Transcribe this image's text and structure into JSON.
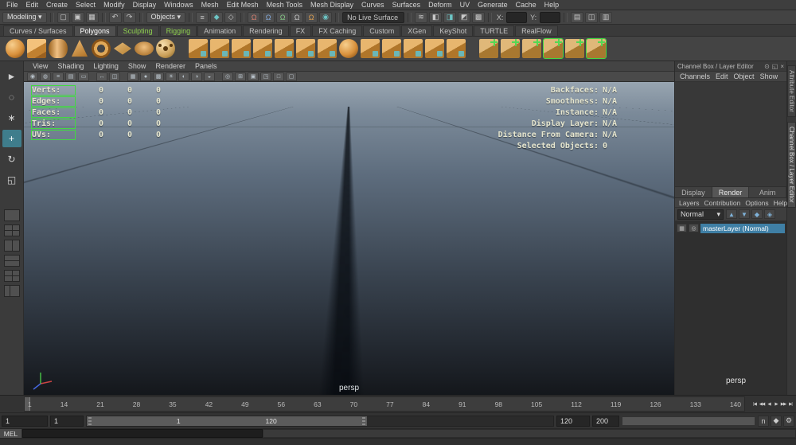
{
  "menu_bar": {
    "items": [
      "File",
      "Edit",
      "Create",
      "Select",
      "Modify",
      "Display",
      "Windows",
      "Mesh",
      "Edit Mesh",
      "Mesh Tools",
      "Mesh Display",
      "Curves",
      "Surfaces",
      "Deform",
      "UV",
      "Generate",
      "Cache",
      "Help"
    ]
  },
  "status_line": {
    "items": [
      {
        "name": "menu-set-dropdown",
        "glyph": "Modeling ▾",
        "cls": "dd"
      },
      {
        "cls": "sep"
      },
      {
        "name": "new-scene-icon",
        "glyph": "▢",
        "cls": "btn"
      },
      {
        "name": "open-scene-icon",
        "glyph": "▣",
        "cls": "btn"
      },
      {
        "name": "save-scene-icon",
        "glyph": "▦",
        "cls": "btn"
      },
      {
        "cls": "sep"
      },
      {
        "name": "undo-icon",
        "glyph": "↶",
        "cls": "btn"
      },
      {
        "name": "redo-icon",
        "glyph": "↷",
        "cls": "btn"
      },
      {
        "cls": "sep"
      },
      {
        "name": "selection-mask-dropdown",
        "glyph": "Objects ▾",
        "cls": "dd"
      },
      {
        "cls": "sep"
      },
      {
        "name": "select-by-hierarchy-icon",
        "glyph": "≡",
        "cls": "btn"
      },
      {
        "name": "select-by-object-icon",
        "glyph": "◆",
        "cls": "btn t-teal"
      },
      {
        "name": "select-by-component-icon",
        "glyph": "◇",
        "cls": "btn"
      },
      {
        "cls": "sep"
      },
      {
        "name": "snap-to-grid-icon",
        "glyph": "Ω",
        "cls": "btn t-red"
      },
      {
        "name": "snap-to-curve-icon",
        "glyph": "Ω",
        "cls": "btn t-blue"
      },
      {
        "name": "snap-to-point-icon",
        "glyph": "Ω",
        "cls": "btn t-green"
      },
      {
        "name": "snap-to-projected-center-icon",
        "glyph": "Ω",
        "cls": "btn"
      },
      {
        "name": "snap-to-view-plane-icon",
        "glyph": "Ω",
        "cls": "btn t-orange"
      },
      {
        "name": "make-live-icon",
        "glyph": "◉",
        "cls": "btn t-teal"
      },
      {
        "cls": "sep"
      },
      {
        "name": "live-surface-field",
        "glyph": "No Live Surface",
        "cls": "field"
      },
      {
        "cls": "sep"
      },
      {
        "name": "construction-history-icon",
        "glyph": "≋",
        "cls": "btn"
      },
      {
        "name": "open-render-view-icon",
        "glyph": "◧",
        "cls": "btn"
      },
      {
        "name": "render-current-frame-icon",
        "glyph": "◨",
        "cls": "btn t-teal"
      },
      {
        "name": "ipr-render-icon",
        "glyph": "◩",
        "cls": "btn"
      },
      {
        "name": "render-settings-icon",
        "glyph": "▩",
        "cls": "btn"
      },
      {
        "cls": "sep"
      },
      {
        "name": "x-coordinate-label",
        "glyph": "X:",
        "cls": "lab"
      },
      {
        "name": "x-coordinate-input",
        "glyph": "",
        "cls": "input"
      },
      {
        "name": "y-coordinate-label",
        "glyph": "Y:",
        "cls": "lab"
      },
      {
        "name": "y-coordinate-input",
        "glyph": "",
        "cls": "input"
      },
      {
        "cls": "sep"
      },
      {
        "name": "channel-box-toggle-icon",
        "glyph": "▤",
        "cls": "btn"
      },
      {
        "name": "attribute-editor-toggle-icon",
        "glyph": "◫",
        "cls": "btn"
      },
      {
        "name": "tool-settings-toggle-icon",
        "glyph": "▥",
        "cls": "btn"
      }
    ]
  },
  "shelf": {
    "tabs": [
      {
        "label": "Curves / Surfaces",
        "cls": ""
      },
      {
        "label": "Polygons",
        "cls": "active"
      },
      {
        "label": "Sculpting",
        "cls": "green"
      },
      {
        "label": "Rigging",
        "cls": "green"
      },
      {
        "label": "Animation",
        "cls": ""
      },
      {
        "label": "Rendering",
        "cls": ""
      },
      {
        "label": "FX",
        "cls": ""
      },
      {
        "label": "FX Caching",
        "cls": ""
      },
      {
        "label": "Custom",
        "cls": ""
      },
      {
        "label": "XGen",
        "cls": ""
      },
      {
        "label": "KeyShot",
        "cls": ""
      },
      {
        "label": "TURTLE",
        "cls": ""
      },
      {
        "label": "RealFlow",
        "cls": ""
      }
    ],
    "icons": [
      {
        "name": "poly-sphere-icon",
        "cls": "sh-sphere"
      },
      {
        "name": "poly-cube-icon",
        "cls": "sh-cube"
      },
      {
        "name": "poly-cylinder-icon",
        "cls": "sh-cyl"
      },
      {
        "name": "poly-cone-icon",
        "cls": "sh-cone"
      },
      {
        "name": "poly-torus-icon",
        "cls": "sh-torus"
      },
      {
        "name": "poly-plane-icon",
        "cls": "sh-plane"
      },
      {
        "name": "poly-disc-icon",
        "cls": "sh-disc"
      },
      {
        "name": "poly-soccer-ball-icon",
        "cls": "sh-soccer"
      },
      {
        "name": "boolean-union-icon",
        "cls": "sh-cube2 gapL"
      },
      {
        "name": "boolean-difference-icon",
        "cls": "sh-cube2"
      },
      {
        "name": "boolean-intersection-icon",
        "cls": "sh-cube2"
      },
      {
        "name": "combine-icon",
        "cls": "sh-cube2"
      },
      {
        "name": "separate-icon",
        "cls": "sh-cube2"
      },
      {
        "name": "extract-icon",
        "cls": "sh-cube2"
      },
      {
        "name": "fill-hole-icon",
        "cls": "sh-cube2"
      },
      {
        "name": "smooth-icon",
        "cls": "sh-sphere"
      },
      {
        "name": "reduce-icon",
        "cls": "sh-cube2"
      },
      {
        "name": "extrude-icon",
        "cls": "sh-cube2"
      },
      {
        "name": "bevel-icon",
        "cls": "sh-cube2"
      },
      {
        "name": "bridge-icon",
        "cls": "sh-cube2"
      },
      {
        "name": "multi-cut-icon",
        "cls": "sh-cube2"
      },
      {
        "name": "insert-edge-loop-icon",
        "cls": "sh-green gapL"
      },
      {
        "name": "offset-edge-loop-icon",
        "cls": "sh-green"
      },
      {
        "name": "crease-tool-icon",
        "cls": "sh-green"
      },
      {
        "name": "quad-draw-icon",
        "cls": "sh-green hl"
      },
      {
        "name": "target-weld-icon",
        "cls": "sh-green"
      },
      {
        "name": "symmetrize-icon",
        "cls": "sh-green hl"
      }
    ]
  },
  "toolbox": {
    "tools": [
      {
        "name": "select-tool-icon",
        "glyph": "►",
        "cls": ""
      },
      {
        "name": "lasso-tool-icon",
        "glyph": "◌",
        "cls": ""
      },
      {
        "name": "paint-select-tool-icon",
        "glyph": "∗",
        "cls": ""
      },
      {
        "name": "move-tool-icon",
        "glyph": "+",
        "cls": "active"
      },
      {
        "name": "rotate-tool-icon",
        "glyph": "↻",
        "cls": ""
      },
      {
        "name": "scale-tool-icon",
        "glyph": "◱",
        "cls": ""
      }
    ],
    "layouts": [
      {
        "name": "single-pane-layout-button",
        "cls": "ly1"
      },
      {
        "name": "four-pane-layout-button",
        "cls": "ly4"
      },
      {
        "name": "two-pane-side-by-side-layout-button",
        "cls": "ly2v"
      },
      {
        "name": "two-pane-stacked-layout-button",
        "cls": "ly2h"
      },
      {
        "name": "three-pane-split-layout-button",
        "cls": "ly3"
      },
      {
        "name": "outliner-persp-layout-button",
        "cls": "lyol"
      }
    ]
  },
  "viewport": {
    "panel_menus": [
      "View",
      "Shading",
      "Lighting",
      "Show",
      "Renderer",
      "Panels"
    ],
    "toolbar_icons": [
      {
        "name": "select-camera-icon",
        "glyph": "◉"
      },
      {
        "name": "lock-camera-icon",
        "glyph": "◍"
      },
      {
        "name": "camera-attributes-icon",
        "glyph": "≡"
      },
      {
        "name": "bookmarks-icon",
        "glyph": "▤"
      },
      {
        "name": "image-plane-icon",
        "glyph": "▭"
      },
      {
        "cls": "sep"
      },
      {
        "name": "two-d-pan-zoom-icon",
        "glyph": "↔"
      },
      {
        "name": "oversampling-icon",
        "glyph": "◫"
      },
      {
        "cls": "sep"
      },
      {
        "name": "wireframe-mode-icon",
        "glyph": "▦"
      },
      {
        "name": "smooth-shade-icon",
        "glyph": "●"
      },
      {
        "name": "textured-mode-icon",
        "glyph": "▩"
      },
      {
        "name": "use-all-lights-icon",
        "glyph": "☀"
      },
      {
        "name": "shadows-icon",
        "glyph": "◐"
      },
      {
        "name": "ambient-occlusion-icon",
        "glyph": "◑"
      },
      {
        "name": "motion-blur-icon",
        "glyph": "◒"
      },
      {
        "cls": "sep"
      },
      {
        "name": "isolate-select-icon",
        "glyph": "◎"
      },
      {
        "name": "field-chart-icon",
        "glyph": "⊞"
      },
      {
        "name": "resolution-gate-icon",
        "glyph": "▣"
      },
      {
        "name": "gate-mask-icon",
        "glyph": "◳"
      },
      {
        "name": "safe-action-icon",
        "glyph": "□"
      },
      {
        "name": "safe-title-icon",
        "glyph": "▢"
      }
    ],
    "hud_left": [
      {
        "label": "Verts:",
        "v0": "0",
        "v1": "0",
        "v2": "0"
      },
      {
        "label": "Edges:",
        "v0": "0",
        "v1": "0",
        "v2": "0"
      },
      {
        "label": "Faces:",
        "v0": "0",
        "v1": "0",
        "v2": "0"
      },
      {
        "label": "Tris:",
        "v0": "0",
        "v1": "0",
        "v2": "0"
      },
      {
        "label": "UVs:",
        "v0": "0",
        "v1": "0",
        "v2": "0"
      }
    ],
    "hud_right": [
      {
        "label": "Backfaces:",
        "value": "N/A"
      },
      {
        "label": "Smoothness:",
        "value": "N/A"
      },
      {
        "label": "Instance:",
        "value": "N/A"
      },
      {
        "label": "Display Layer:",
        "value": "N/A"
      },
      {
        "label": "Distance From Camera:",
        "value": "N/A"
      },
      {
        "label": "Selected Objects:",
        "value": "0"
      }
    ],
    "camera_label": "persp"
  },
  "channel_box": {
    "title": "Channel Box / Layer Editor",
    "header_icons": [
      {
        "name": "pin-panel-icon",
        "glyph": "⊙"
      },
      {
        "name": "pop-out-panel-icon",
        "glyph": "◱"
      },
      {
        "name": "close-panel-icon",
        "glyph": "×"
      }
    ],
    "menus": [
      "Channels",
      "Edit",
      "Object",
      "Show"
    ],
    "layer_editor": {
      "tabs": [
        {
          "label": "Display",
          "cls": ""
        },
        {
          "label": "Render",
          "cls": "active"
        },
        {
          "label": "Anim",
          "cls": ""
        }
      ],
      "menus": [
        "Layers",
        "Contribution",
        "Options",
        "Help"
      ],
      "blend_mode": "Normal",
      "caret": "▾",
      "control_icons": [
        {
          "name": "move-layer-up-icon",
          "glyph": "▲"
        },
        {
          "name": "move-layer-down-icon",
          "glyph": "▼"
        },
        {
          "name": "create-empty-layer-icon",
          "glyph": "◆"
        },
        {
          "name": "create-layer-from-selected-icon",
          "glyph": "◈"
        }
      ],
      "visibility_glyph": "▦",
      "renderable_glyph": "◎",
      "layers": [
        {
          "name": "masterLayer (Normal)"
        }
      ]
    }
  },
  "side_tabs": [
    {
      "name": "attribute-editor-tab",
      "label": "Attribute Editor",
      "cls": ""
    },
    {
      "name": "channel-box-tab",
      "label": "Channel Box / Layer Editor",
      "cls": "active"
    }
  ],
  "time_slider": {
    "ticks": [
      "1",
      "14",
      "21",
      "28",
      "35",
      "42",
      "49",
      "56",
      "63",
      "70",
      "77",
      "84",
      "91",
      "98",
      "105",
      "112",
      "119",
      "126",
      "133",
      "140"
    ],
    "playback_buttons": [
      {
        "name": "go-to-start-button",
        "glyph": "|◀"
      },
      {
        "name": "step-back-frame-button",
        "glyph": "◀◀"
      },
      {
        "name": "play-backwards-button",
        "glyph": "◀"
      },
      {
        "name": "play-forwards-button",
        "glyph": "▶"
      },
      {
        "name": "step-forward-frame-button",
        "glyph": "▶▶"
      },
      {
        "name": "go-to-end-button",
        "glyph": "▶|"
      }
    ]
  },
  "range_slider": {
    "animation_start": "1",
    "playback_start": "1",
    "range_bar_start": "1",
    "range_bar_end": "120",
    "playback_end": "120",
    "animation_end": "200",
    "icons": [
      {
        "name": "no-character-set-icon",
        "glyph": "n",
        "cls": "t-gray"
      },
      {
        "name": "auto-keyframe-icon",
        "glyph": "◆",
        "cls": "t-orange"
      },
      {
        "name": "animation-preferences-icon",
        "glyph": "⚙",
        "cls": "t-teal"
      }
    ]
  },
  "command_line": {
    "mode_label": "MEL",
    "input_value": "",
    "output_value": ""
  },
  "misc": {
    "right_panel_persp": "persp"
  }
}
